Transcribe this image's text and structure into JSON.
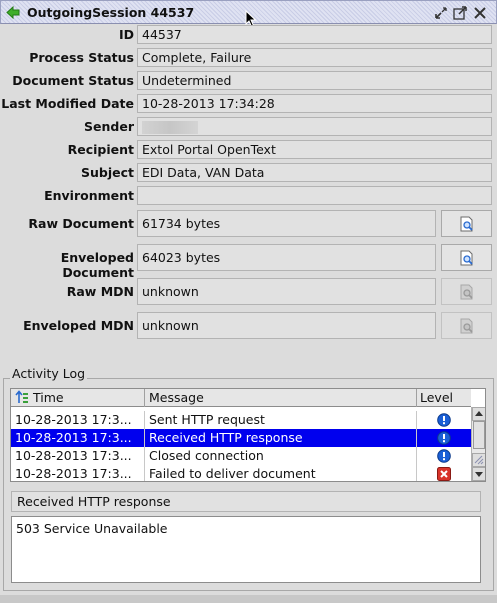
{
  "window": {
    "title": "OutgoingSession 44537",
    "icons": [
      "back-arrow-icon",
      "minimize-icon",
      "maximize-icon",
      "close-icon"
    ]
  },
  "fields": {
    "id": {
      "label": "ID",
      "value": "44537"
    },
    "process_status": {
      "label": "Process Status",
      "value": "Complete, Failure"
    },
    "document_status": {
      "label": "Document Status",
      "value": "Undetermined"
    },
    "last_modified": {
      "label": "Last Modified Date",
      "value": "10-28-2013 17:34:28"
    },
    "sender": {
      "label": "Sender",
      "value": ""
    },
    "recipient": {
      "label": "Recipient",
      "value": "Extol Portal OpenText"
    },
    "subject": {
      "label": "Subject",
      "value": "EDI Data, VAN Data"
    },
    "environment": {
      "label": "Environment",
      "value": ""
    },
    "raw_document": {
      "label": "Raw Document",
      "value": "61734 bytes"
    },
    "enveloped_document": {
      "label": "Enveloped Document",
      "value": "64023 bytes"
    },
    "raw_mdn": {
      "label": "Raw MDN",
      "value": "unknown"
    },
    "enveloped_mdn": {
      "label": "Enveloped MDN",
      "value": "unknown"
    }
  },
  "activity_log": {
    "title": "Activity Log",
    "columns": [
      "Time",
      "Message",
      "Level"
    ],
    "rows": [
      {
        "time": "10-28-2013 17:3...",
        "message": "Sent HTTP request",
        "level": "info-icon",
        "selected": false
      },
      {
        "time": "10-28-2013 17:3...",
        "message": "Received HTTP response",
        "level": "info-icon",
        "selected": true
      },
      {
        "time": "10-28-2013 17:3...",
        "message": "Closed connection",
        "level": "info-icon",
        "selected": false
      },
      {
        "time": "10-28-2013 17:3...",
        "message": "Failed to deliver document",
        "level": "error-icon",
        "selected": false
      }
    ],
    "selected_message": "Received HTTP response",
    "detail_text": "503 Service Unavailable"
  },
  "colors": {
    "selection": "#0000ee",
    "info": "#1a5fd6",
    "error": "#d8332a"
  }
}
